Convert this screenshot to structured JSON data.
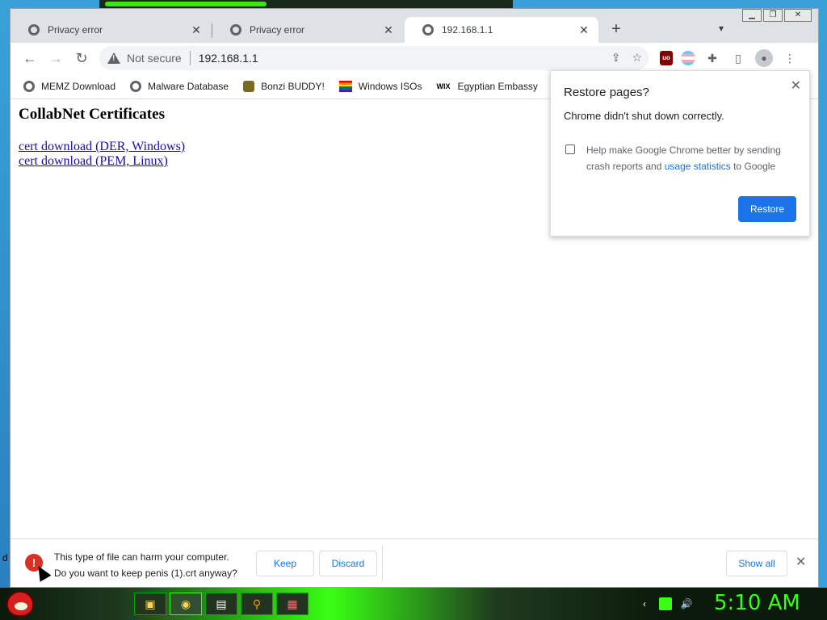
{
  "tabs": [
    {
      "title": "Privacy error"
    },
    {
      "title": "Privacy error"
    },
    {
      "title": "192.168.1.1",
      "active": true
    }
  ],
  "toolbar": {
    "security_label": "Not secure",
    "url": "192.168.1.1"
  },
  "bookmarks": [
    {
      "label": "MEMZ Download",
      "icon": "globe-icon"
    },
    {
      "label": "Malware Database",
      "icon": "globe-icon"
    },
    {
      "label": "Bonzi BUDDY!",
      "icon": "bonzi-icon"
    },
    {
      "label": "Windows ISOs",
      "icon": "rainbow-flag-icon"
    },
    {
      "label": "Egyptian Embassy",
      "icon": "wix-icon"
    }
  ],
  "page": {
    "heading": "CollabNet Certificates",
    "links": [
      "cert download (DER, Windows)",
      "cert download (PEM, Linux)"
    ]
  },
  "restore_popup": {
    "title": "Restore pages?",
    "description": "Chrome didn't shut down correctly.",
    "help_text_before": "Help make Google Chrome better by sending crash reports and ",
    "help_link": "usage statistics",
    "help_text_after": " to Google",
    "button": "Restore"
  },
  "download_bar": {
    "line1": "This type of file can harm your computer.",
    "line2": "Do you want to keep penis (1).crt anyway?",
    "keep": "Keep",
    "discard": "Discard",
    "show_all": "Show all"
  },
  "taskbar": {
    "clock": "5:10 AM"
  },
  "desktop": {
    "edge_label": "d"
  },
  "colors": {
    "accent": "#1a73e8",
    "warning": "#d93025",
    "clock": "#39ff14"
  }
}
